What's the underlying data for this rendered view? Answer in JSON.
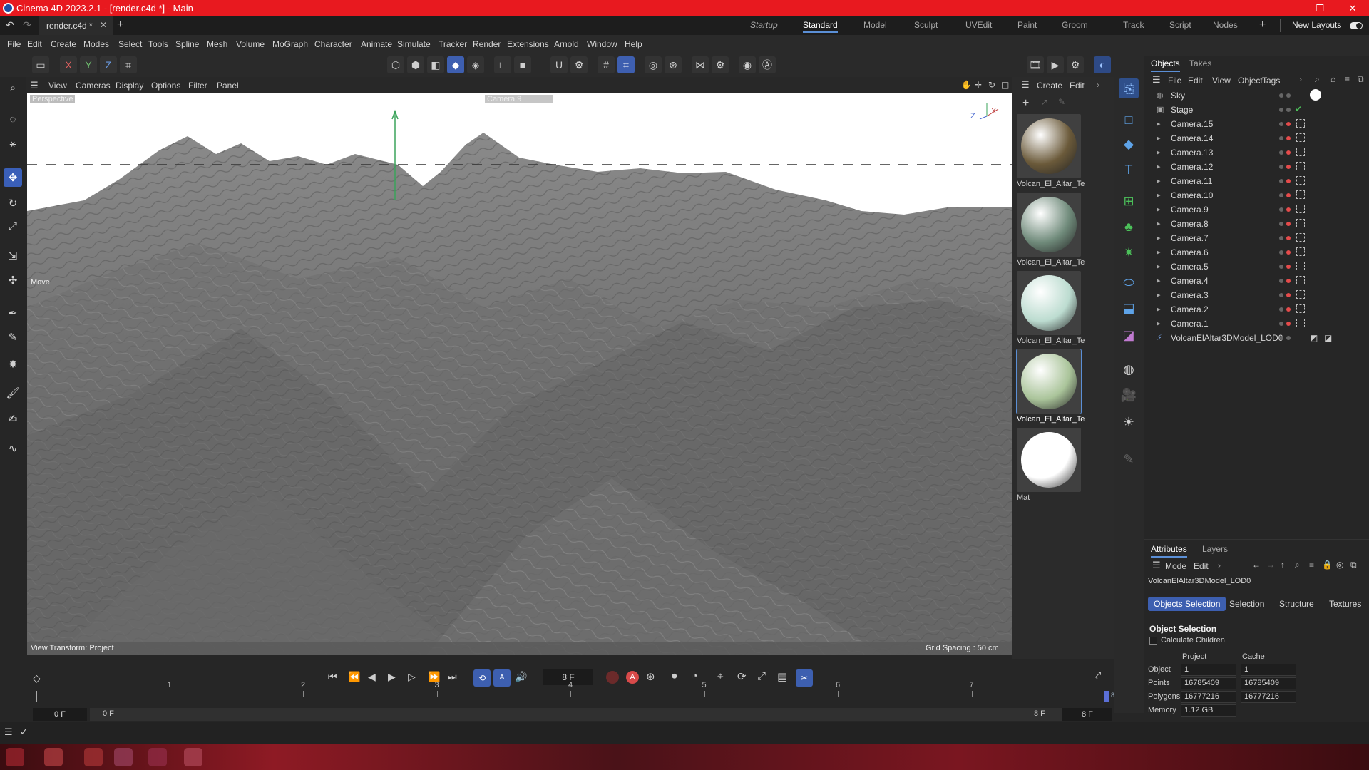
{
  "window": {
    "title": "Cinema 4D 2023.2.1 - [render.c4d *] - Main"
  },
  "doc_tab": {
    "label": "render.c4d *"
  },
  "layouts": [
    "Startup",
    "Standard",
    "Model",
    "Sculpt",
    "UVEdit",
    "Paint",
    "Groom",
    "Track",
    "Script",
    "Nodes"
  ],
  "active_layout": "Standard",
  "new_layouts_label": "New Layouts",
  "menu": [
    "File",
    "Edit",
    "Create",
    "Modes",
    "Select",
    "Tools",
    "Spline",
    "Mesh",
    "Volume",
    "MoGraph",
    "Character",
    "Animate",
    "Simulate",
    "Tracker",
    "Render",
    "Extensions",
    "Arnold",
    "Window",
    "Help"
  ],
  "axis_lock": [
    "X",
    "Y",
    "Z"
  ],
  "viewport": {
    "menu": [
      "View",
      "Cameras",
      "Display",
      "Options",
      "Filter",
      "Panel"
    ],
    "projection_label": "Perspective",
    "camera_label": "Camera.9",
    "move_label": "Move",
    "view_transform": "View Transform: Project",
    "grid_spacing": "Grid Spacing : 50 cm",
    "axis_x": "X",
    "axis_z": "Z"
  },
  "material_panel": {
    "menu": [
      "Create",
      "Edit"
    ],
    "materials": [
      {
        "label": "Volcan_El_Altar_Te",
        "color": "#6b5a3a"
      },
      {
        "label": "Volcan_El_Altar_Te",
        "color": "#6f8a7a"
      },
      {
        "label": "Volcan_El_Altar_Te",
        "color": "#bcdcd0"
      },
      {
        "label": "Volcan_El_Altar_Te",
        "color": "#aac49a"
      },
      {
        "label": "Mat",
        "color": "#ffffff"
      }
    ]
  },
  "objects": {
    "tabs": [
      "Objects",
      "Takes"
    ],
    "menu": [
      "File",
      "Edit",
      "View",
      "Object",
      "Tags"
    ],
    "items": [
      "Sky",
      "Stage",
      "Camera.15",
      "Camera.14",
      "Camera.13",
      "Camera.12",
      "Camera.11",
      "Camera.10",
      "Camera.9",
      "Camera.8",
      "Camera.7",
      "Camera.6",
      "Camera.5",
      "Camera.4",
      "Camera.3",
      "Camera.2",
      "Camera.1",
      "VolcanElAltar3DModel_LOD0"
    ]
  },
  "attributes": {
    "tabs": [
      "Attributes",
      "Layers"
    ],
    "menu": [
      "Mode",
      "Edit"
    ],
    "object_name": "VolcanElAltar3DModel_LOD0",
    "subtabs": [
      "Objects Selection",
      "Selection",
      "Structure",
      "Textures"
    ],
    "section_title": "Object Selection",
    "calc_children_label": "Calculate Children",
    "col_project": "Project",
    "col_cache": "Cache",
    "rows": [
      {
        "label": "Object",
        "project": "1",
        "cache": "1"
      },
      {
        "label": "Points",
        "project": "16785409",
        "cache": "16785409"
      },
      {
        "label": "Polygons",
        "project": "16777216",
        "cache": "16777216"
      },
      {
        "label": "Memory",
        "project": "1.12 GB",
        "cache": ""
      }
    ]
  },
  "timeline": {
    "current_frame": "8 F",
    "ticks": [
      "1",
      "2",
      "3",
      "4",
      "5",
      "6",
      "7"
    ],
    "start_frame": "0 F",
    "range_start": "0 F",
    "range_end": "8 F",
    "end_frame": "8 F",
    "end_marker": "8"
  },
  "colors": {
    "titlebar": "#e8191f",
    "accent": "#3d5fb0",
    "dot_red": "#e54b4b"
  }
}
